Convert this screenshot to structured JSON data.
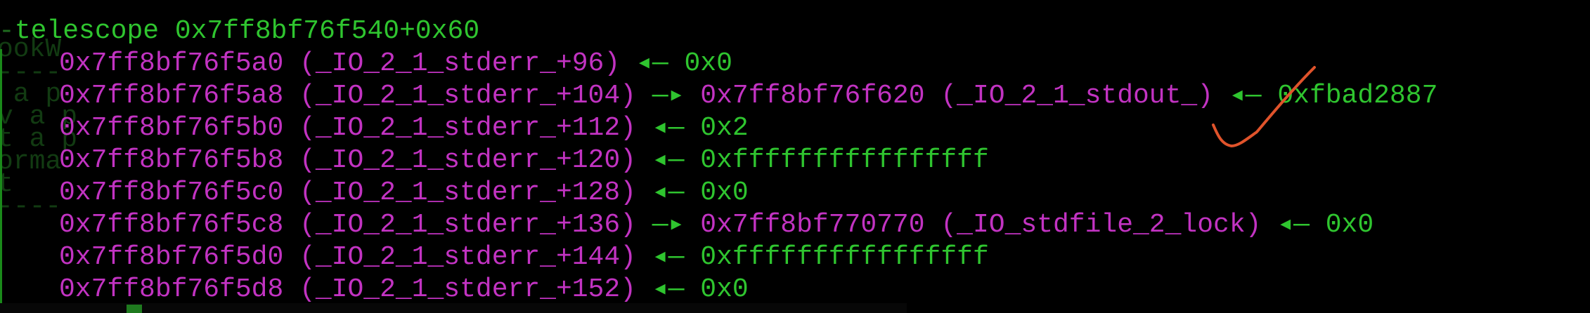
{
  "command": {
    "prefix": "-",
    "text": "telescope 0x7ff8bf76f540+0x60"
  },
  "background_fragments": [
    "ookW",
    "----",
    " a p",
    "v a p",
    "t a p",
    "orma",
    "t",
    "----"
  ],
  "rows": [
    {
      "addr": "0x7ff8bf76f5a0",
      "sym": "(_IO_2_1_stderr_+96)",
      "arrow": "◂—",
      "target": "",
      "target_sym": "",
      "arrow2": "",
      "value": "0x0"
    },
    {
      "addr": "0x7ff8bf76f5a8",
      "sym": "(_IO_2_1_stderr_+104)",
      "arrow": "—▸",
      "target": "0x7ff8bf76f620",
      "target_sym": "(_IO_2_1_stdout_)",
      "arrow2": "◂—",
      "value": "0xfbad2887"
    },
    {
      "addr": "0x7ff8bf76f5b0",
      "sym": "(_IO_2_1_stderr_+112)",
      "arrow": "◂—",
      "target": "",
      "target_sym": "",
      "arrow2": "",
      "value": "0x2"
    },
    {
      "addr": "0x7ff8bf76f5b8",
      "sym": "(_IO_2_1_stderr_+120)",
      "arrow": "◂—",
      "target": "",
      "target_sym": "",
      "arrow2": "",
      "value": "0xffffffffffffffff"
    },
    {
      "addr": "0x7ff8bf76f5c0",
      "sym": "(_IO_2_1_stderr_+128)",
      "arrow": "◂—",
      "target": "",
      "target_sym": "",
      "arrow2": "",
      "value": "0x0"
    },
    {
      "addr": "0x7ff8bf76f5c8",
      "sym": "(_IO_2_1_stderr_+136)",
      "arrow": "—▸",
      "target": "0x7ff8bf770770",
      "target_sym": "(_IO_stdfile_2_lock)",
      "arrow2": "◂—",
      "value": "0x0"
    },
    {
      "addr": "0x7ff8bf76f5d0",
      "sym": "(_IO_2_1_stderr_+144)",
      "arrow": "◂—",
      "target": "",
      "target_sym": "",
      "arrow2": "",
      "value": "0xffffffffffffffff"
    },
    {
      "addr": "0x7ff8bf76f5d8",
      "sym": "(_IO_2_1_stderr_+152)",
      "arrow": "◂—",
      "target": "",
      "target_sym": "",
      "arrow2": "",
      "value": "0x0"
    }
  ],
  "colors": {
    "background": "#000000",
    "address": "#c233c2",
    "value": "#2fc52f",
    "annotation": "#e0532b"
  }
}
